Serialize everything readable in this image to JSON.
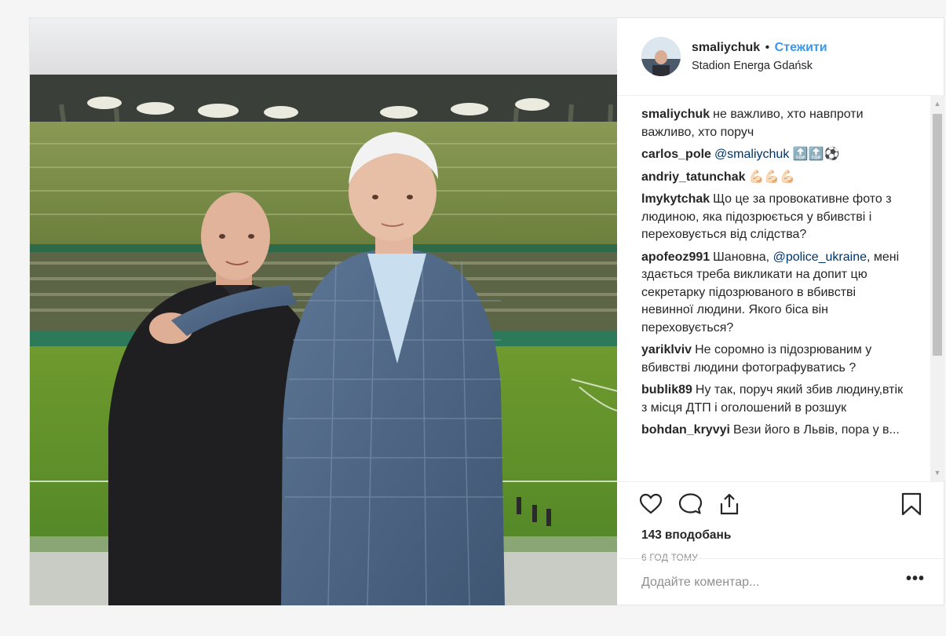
{
  "post": {
    "username": "smaliychuk",
    "separator": "•",
    "follow_label": "Стежити",
    "location": "Stadion Energa Gdańsk",
    "likes_count": "143",
    "likes_label": "вподобань",
    "time_ago": "6 ГОД ТОМУ",
    "comment_placeholder": "Додайте коментар...",
    "more_label": "•••"
  },
  "comments": [
    {
      "user": "smaliychuk",
      "text": "не важливо, хто навпроти важливо, хто поруч"
    },
    {
      "user": "carlos_pole",
      "mention": "@smaliychuk",
      "text": "🔝🔝⚽"
    },
    {
      "user": "andriy_tatunchak",
      "text": "💪🏻💪🏻💪🏻"
    },
    {
      "user": "lmykytchak",
      "text": "Що це за провокативне фото з людиною, яка підозрюється у вбивстві і переховується від слідства?"
    },
    {
      "user": "apofeoz991",
      "text_before": "Шановна,",
      "mention": "@police_ukraine",
      "text": ", мені здається треба викликати на допит цю секретарку підозрюваного в вбивстві невинної людини. Якого біса він переховується?"
    },
    {
      "user": "yariklviv",
      "text": "Не соромно із підозрюваним у вбивстві людини фотографуватись ?"
    },
    {
      "user": "bublik89",
      "text": "Ну так, поруч який збив людину,втік з місця ДТП і оголошений в розшук"
    },
    {
      "user": "bohdan_kryvyi",
      "text": "Вези його в Львів, пора у в..."
    }
  ],
  "icons": {
    "like": "heart-outline-icon",
    "comment": "speech-bubble-icon",
    "share": "share-upload-icon",
    "save": "bookmark-icon",
    "scroll_up": "triangle-up",
    "scroll_down": "triangle-down"
  },
  "colors": {
    "follow": "#3897f0",
    "mention": "#003569",
    "muted": "#8e8e8e",
    "text": "#262626"
  }
}
